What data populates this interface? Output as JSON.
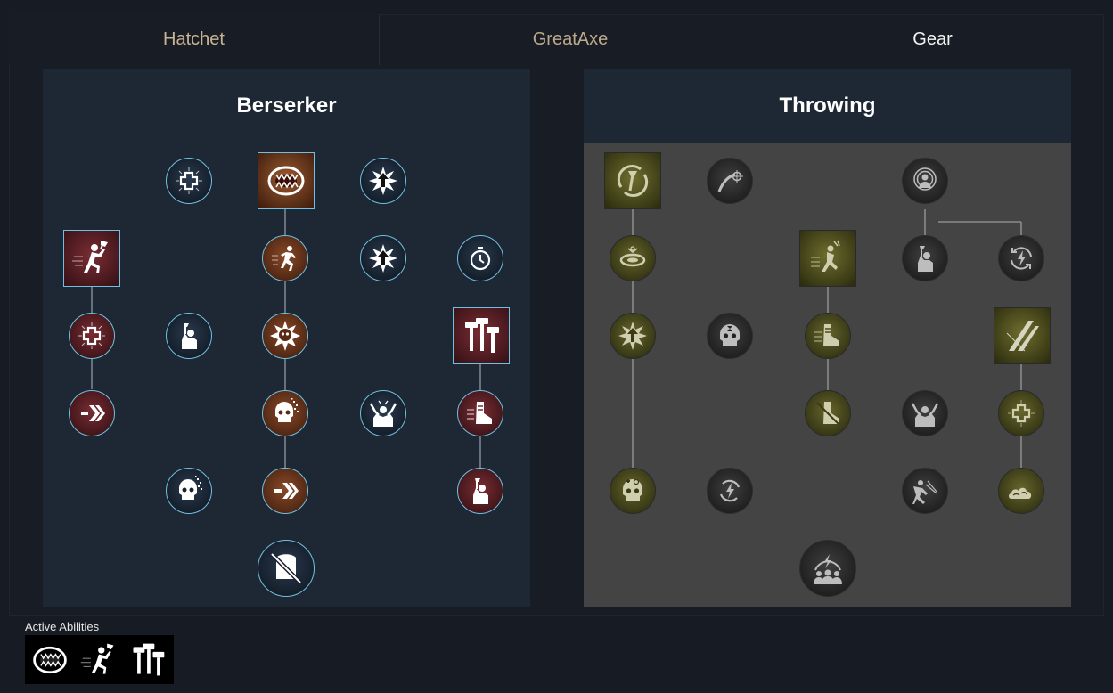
{
  "tabs": [
    {
      "label": "Hatchet"
    },
    {
      "label": "GreatAxe"
    },
    {
      "label": "Gear"
    }
  ],
  "trees": [
    {
      "title": "Berserker"
    },
    {
      "title": "Throwing"
    }
  ],
  "active_abilities": {
    "label": "Active Abilities",
    "icons": [
      "roar-mouth-icon",
      "axe-runner-icon",
      "hammers-icon"
    ]
  }
}
